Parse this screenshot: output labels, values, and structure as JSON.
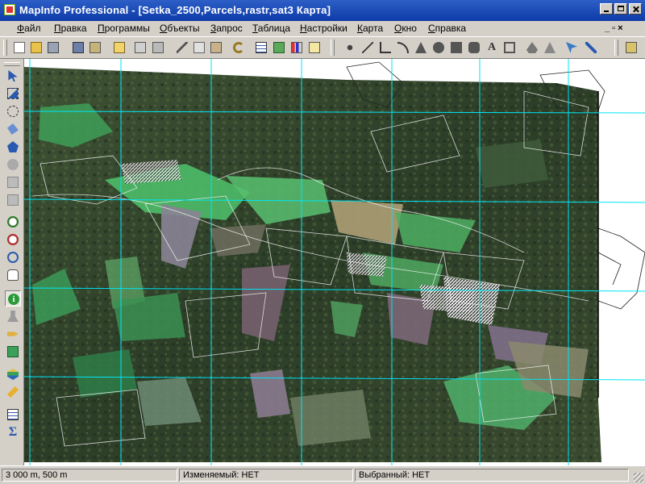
{
  "window": {
    "title": "MapInfo Professional - [Setka_2500,Parcels,rastr,sat3 Карта]"
  },
  "menu": {
    "items": [
      "Файл",
      "Правка",
      "Программы",
      "Объекты",
      "Запрос",
      "Таблица",
      "Настройки",
      "Карта",
      "Окно",
      "Справка"
    ],
    "mdi_controls": "_ ▫ ×"
  },
  "toolbar": {
    "icons": [
      "new-file-icon",
      "open-file-icon",
      "save-icon",
      "save-copy-icon",
      "open-workspace-icon",
      "print-preview-icon",
      "print-icon",
      "cut-icon",
      "copy-icon",
      "paste-icon",
      "undo-icon",
      "browser-icon",
      "map-window-icon",
      "graph-icon",
      "layout-icon",
      "symbol-icon",
      "line-icon",
      "polyline-icon",
      "arc-icon",
      "polygon-icon",
      "ellipse-icon",
      "rectangle-icon",
      "rounded-rectangle-icon",
      "text-icon",
      "frame-icon",
      "reshape-icon",
      "add-node-icon",
      "pointer-style-icon",
      "line-style-icon",
      "tool-manager-icon"
    ]
  },
  "toolbox": {
    "icons": [
      "select-icon",
      "marquee-select-icon",
      "radius-select-icon",
      "boundary-select-icon",
      "polygon-select-icon",
      "invert-select-icon",
      "graph-select-icon",
      "unselect-icon",
      "zoom-in-icon",
      "zoom-out-icon",
      "change-view-icon",
      "grabber-icon",
      "info-icon",
      "hotlink-icon",
      "label-icon",
      "drag-map-icon",
      "layer-control-icon",
      "ruler-icon",
      "legend-icon",
      "statistics-icon"
    ]
  },
  "status": {
    "zoom": "3 000 m, 500 m",
    "editable": "Изменяемый: НЕТ",
    "selectable": "Выбранный: НЕТ"
  },
  "colors": {
    "grid_line": "#00e5f5",
    "title_bar": "#1c4bb5"
  }
}
